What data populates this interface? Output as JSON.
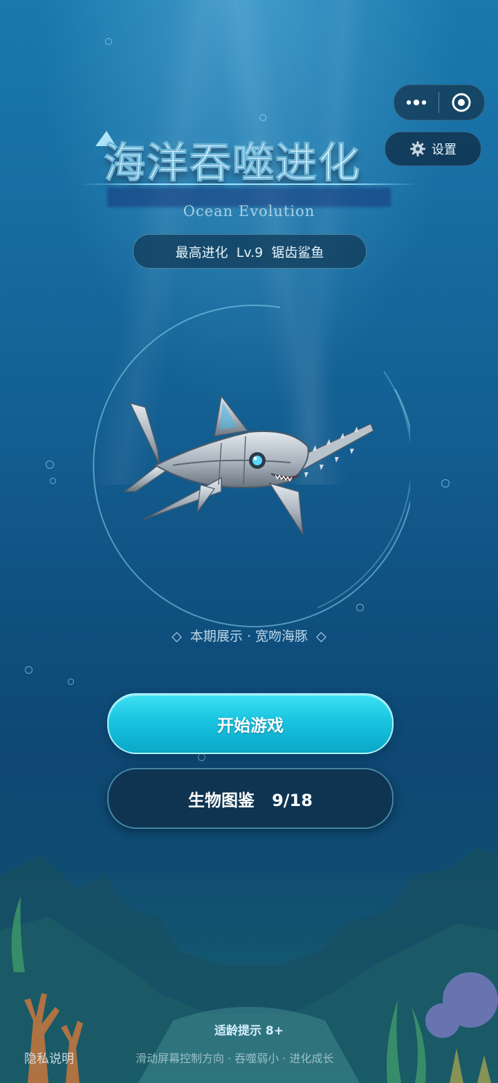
{
  "game": {
    "title": "海洋吞噬进化",
    "subtitle": "Ocean Evolution",
    "best_record": "最高进化  Lv.9  锯齿鲨鱼",
    "showcase": "◇  本期展示 · 宽吻海豚  ◇"
  },
  "capsule": {
    "more_icon": "more-dots-icon",
    "close_icon": "target-close-icon"
  },
  "settings": {
    "icon": "gear-icon",
    "label": "设置"
  },
  "buttons": {
    "start": "开始游戏",
    "dex": "生物图鉴   9/18"
  },
  "footer": {
    "age_hint": "适龄提示 8+",
    "privacy": "隐私说明",
    "tips": "滑动屏幕控制方向 · 吞噬弱小 · 进化成长"
  },
  "colors": {
    "accent": "#18c4e0",
    "ocean": "#135e91"
  }
}
